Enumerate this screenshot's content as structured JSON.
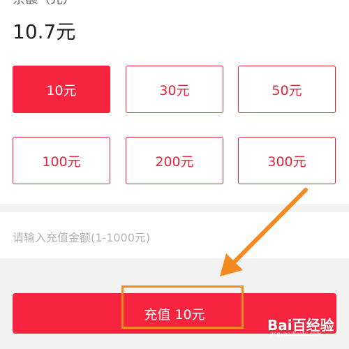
{
  "balance": {
    "label": "余额（元）",
    "value": "10.7元"
  },
  "amount_options": [
    {
      "label": "10元",
      "selected": true
    },
    {
      "label": "30元",
      "selected": false
    },
    {
      "label": "50元",
      "selected": false
    },
    {
      "label": "100元",
      "selected": false
    },
    {
      "label": "200元",
      "selected": false
    },
    {
      "label": "300元",
      "selected": false
    }
  ],
  "custom_amount": {
    "value": "",
    "placeholder": "请输入充值金额(1-1000元)"
  },
  "recharge_button": {
    "label": "充值 10元"
  },
  "watermark": {
    "brand": "Bai百经验",
    "url": "jingyan.baidu.com"
  },
  "colors": {
    "accent": "#f7243f",
    "annotation": "#f58a21"
  }
}
